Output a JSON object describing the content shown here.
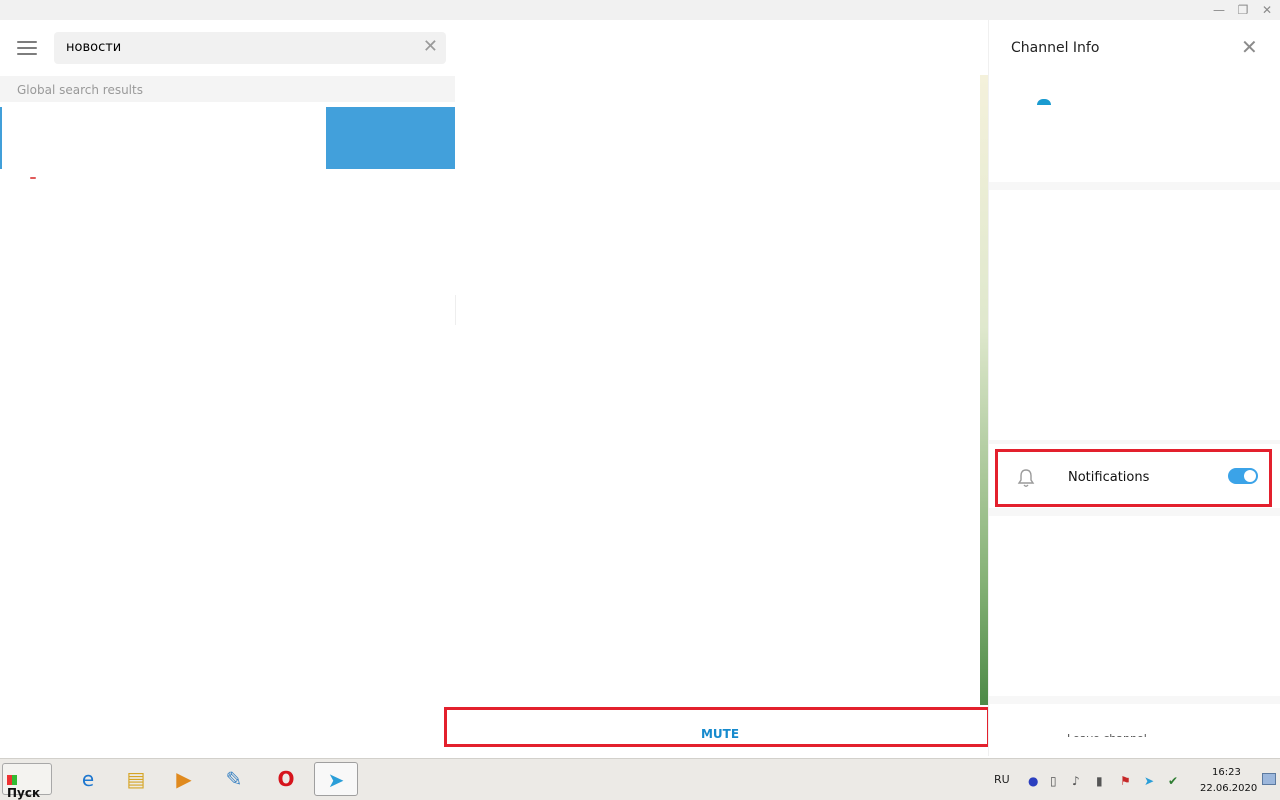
{
  "window": {
    "min_icon": "minimize-icon",
    "max_icon": "restore-icon",
    "close_icon": "close-icon",
    "min_glyph": "—",
    "max_glyph": "❐",
    "close_glyph": "✕"
  },
  "left_pane": {
    "search": {
      "value": "новости",
      "clear_glyph": "✕"
    },
    "section_header": "Global search results"
  },
  "chat": {
    "mute_label": "MUTE"
  },
  "channel_info": {
    "title": "Channel Info",
    "close_glyph": "✕",
    "notifications": {
      "label": "Notifications",
      "enabled": true
    },
    "leave_label": "Leave channel"
  },
  "taskbar": {
    "start_label": "Пуск",
    "apps": [
      {
        "name": "internet-explorer",
        "glyph": "e",
        "color": "#1e77cf"
      },
      {
        "name": "file-explorer",
        "glyph": "▤",
        "color": "#d6a526"
      },
      {
        "name": "media-player",
        "glyph": "▶",
        "color": "#e08a1e"
      },
      {
        "name": "paint",
        "glyph": "✎",
        "color": "#3c84c4"
      },
      {
        "name": "opera",
        "glyph": "O",
        "color": "#d6141c"
      },
      {
        "name": "telegram",
        "glyph": "➤",
        "color": "#2a9ed8"
      }
    ],
    "language": "RU",
    "clock_time": "16:23",
    "clock_date": "22.06.2020"
  },
  "colors": {
    "highlight": "#e3202d",
    "accent": "#168acd",
    "toggle": "#3ba3e8"
  }
}
